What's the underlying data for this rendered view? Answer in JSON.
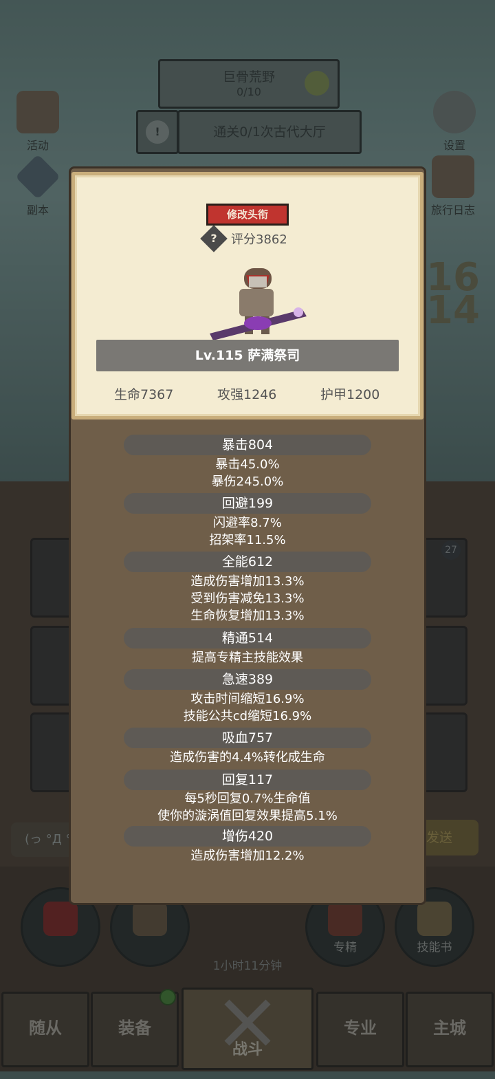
{
  "top": {
    "zone_name": "巨骨荒野",
    "zone_progress": "0/10",
    "quest_text": "通关0/1次古代大厅"
  },
  "side_left": [
    {
      "label": "活动",
      "icon": "book-icon"
    },
    {
      "label": "副本",
      "icon": "crystal-icon"
    }
  ],
  "side_right": [
    {
      "label": "设置",
      "icon": "gear-icon"
    },
    {
      "label": "旅行日志",
      "icon": "journal-icon"
    }
  ],
  "background_numbers": [
    "16",
    "14"
  ],
  "slot_badge": "27",
  "chat": {
    "placeholder": "(っ °Д °",
    "send_label": "发送"
  },
  "bottom_buttons": [
    {
      "label": "",
      "icon": "potion-icon"
    },
    {
      "label": "",
      "icon": "bread-icon"
    },
    {
      "label": "专精",
      "icon": "spec-icon"
    },
    {
      "label": "技能书",
      "icon": "skillbook-icon"
    }
  ],
  "timer": "1小时11分钟",
  "nav": {
    "tabs": [
      {
        "label": "随从"
      },
      {
        "label": "装备"
      },
      {
        "label": "战斗",
        "active": true
      },
      {
        "label": "专业"
      },
      {
        "label": "主城"
      }
    ]
  },
  "profile": {
    "title_button": "修改头衔",
    "score": "评分3862",
    "name": "Lv.115 萨满祭司",
    "hp": "生命7367",
    "atk": "攻强1246",
    "armor": "护甲1200"
  },
  "stats": [
    {
      "header": "暴击804",
      "lines": [
        "暴击45.0%",
        "暴伤245.0%"
      ]
    },
    {
      "header": "回避199",
      "lines": [
        "闪避率8.7%",
        "招架率11.5%"
      ]
    },
    {
      "header": "全能612",
      "lines": [
        "造成伤害增加13.3%",
        "受到伤害减免13.3%",
        "生命恢复增加13.3%"
      ]
    },
    {
      "header": "精通514",
      "lines": [
        "提高专精主技能效果"
      ]
    },
    {
      "header": "急速389",
      "lines": [
        "攻击时间缩短16.9%",
        "技能公共cd缩短16.9%"
      ]
    },
    {
      "header": "吸血757",
      "lines": [
        "造成伤害的4.4%转化成生命"
      ]
    },
    {
      "header": "回复117",
      "lines": [
        "每5秒回复0.7%生命值",
        "使你的漩涡值回复效果提高5.1%"
      ]
    },
    {
      "header": "增伤420",
      "lines": [
        "造成伤害增加12.2%"
      ]
    }
  ],
  "colors": {
    "accent_red": "#c0342f",
    "panel_brown": "#6f5e49",
    "paper": "#f4ecd2"
  }
}
